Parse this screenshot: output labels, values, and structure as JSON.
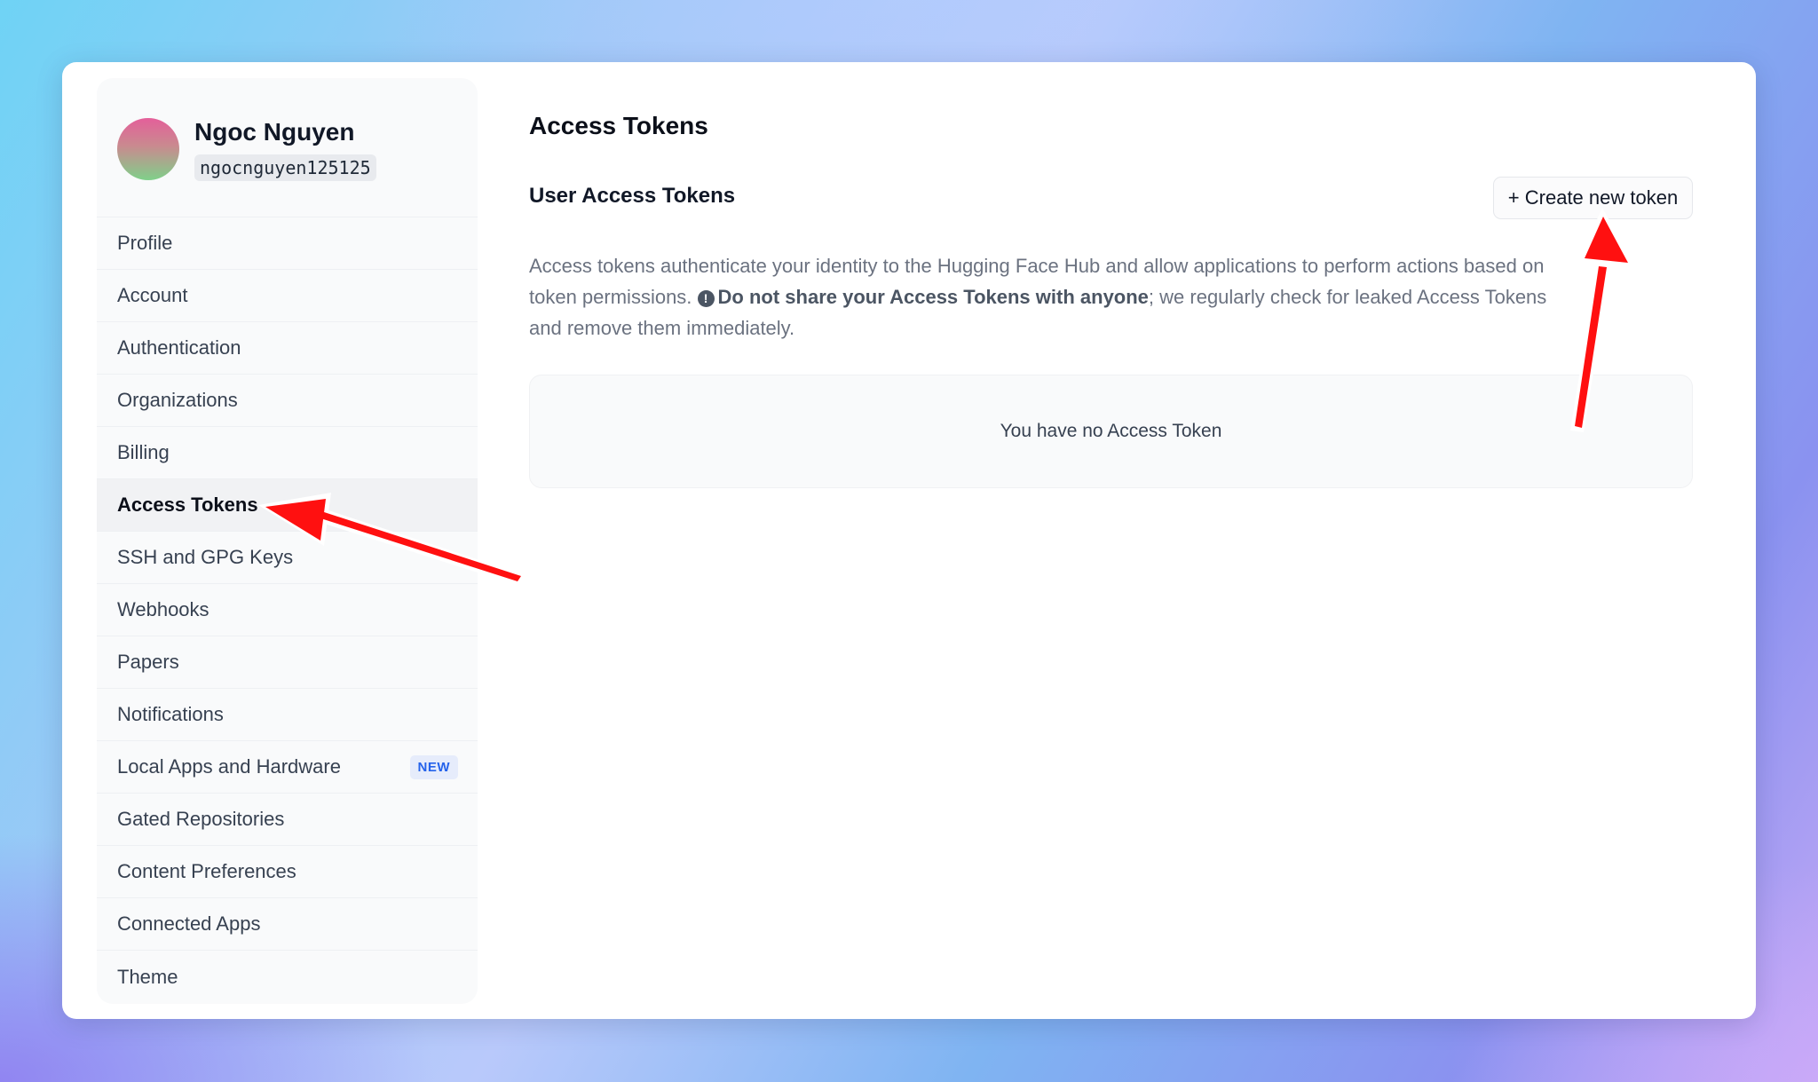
{
  "user": {
    "name": "Ngoc Nguyen",
    "handle": "ngocnguyen125125"
  },
  "sidebar": {
    "items": [
      {
        "label": "Profile"
      },
      {
        "label": "Account"
      },
      {
        "label": "Authentication"
      },
      {
        "label": "Organizations"
      },
      {
        "label": "Billing"
      },
      {
        "label": "Access Tokens",
        "active": true
      },
      {
        "label": "SSH and GPG Keys"
      },
      {
        "label": "Webhooks"
      },
      {
        "label": "Papers"
      },
      {
        "label": "Notifications"
      },
      {
        "label": "Local Apps and Hardware",
        "badge": "NEW"
      },
      {
        "label": "Gated Repositories"
      },
      {
        "label": "Content Preferences"
      },
      {
        "label": "Connected Apps"
      },
      {
        "label": "Theme"
      }
    ]
  },
  "main": {
    "title": "Access Tokens",
    "section_title": "User Access Tokens",
    "create_button": "+ Create new token",
    "description_part1": "Access tokens authenticate your identity to the Hugging Face Hub and allow applications to perform actions based on token permissions.",
    "warning_icon": "!",
    "description_bold1": "Do not share your",
    "description_bold2": "Access Tokens",
    "description_bold3": "with anyone",
    "description_part2": "; we regularly check for leaked Access Tokens and remove them immediately.",
    "empty_state": "You have no Access Token"
  },
  "icons": {
    "warning": "exclamation-circle-icon",
    "annotation": "red-arrow"
  },
  "colors": {
    "accent_arrow": "#ff1010",
    "badge_text": "#2563eb"
  }
}
